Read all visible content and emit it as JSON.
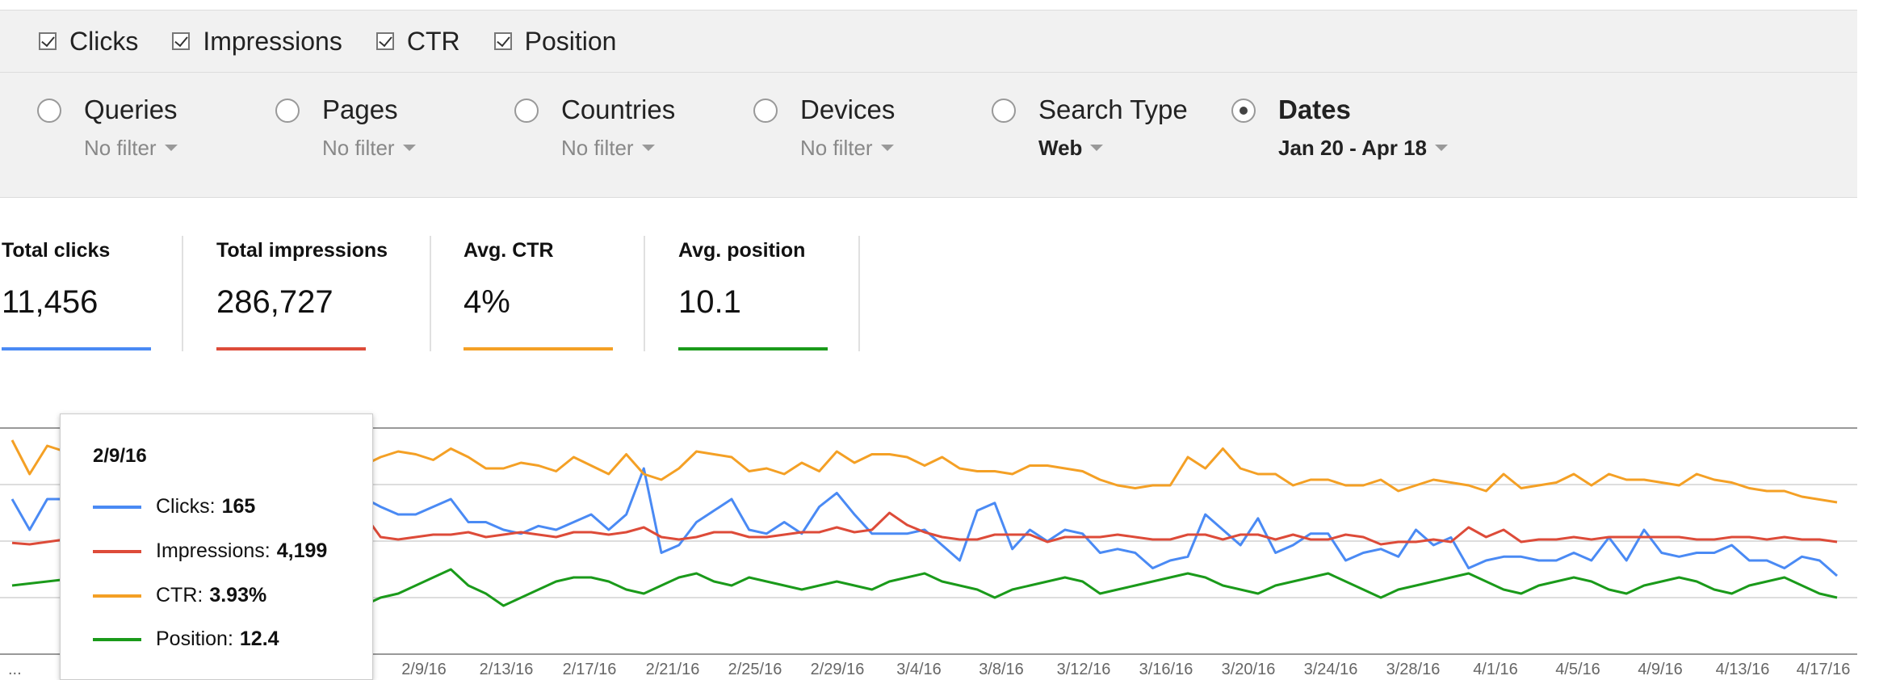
{
  "metrics": [
    {
      "label": "Clicks",
      "checked": true
    },
    {
      "label": "Impressions",
      "checked": true
    },
    {
      "label": "CTR",
      "checked": true
    },
    {
      "label": "Position",
      "checked": true
    }
  ],
  "filters": [
    {
      "title": "Queries",
      "value": "No filter",
      "selected": false
    },
    {
      "title": "Pages",
      "value": "No filter",
      "selected": false
    },
    {
      "title": "Countries",
      "value": "No filter",
      "selected": false
    },
    {
      "title": "Devices",
      "value": "No filter",
      "selected": false
    },
    {
      "title": "Search Type",
      "value": "Web",
      "selected": false
    },
    {
      "title": "Dates",
      "value": "Jan 20 - Apr 18",
      "selected": true
    }
  ],
  "scorecards": [
    {
      "label": "Total clicks",
      "value": "11,456",
      "color": "#4a8af4"
    },
    {
      "label": "Total impressions",
      "value": "286,727",
      "color": "#dd4b39"
    },
    {
      "label": "Avg. CTR",
      "value": "4%",
      "color": "#f4a025"
    },
    {
      "label": "Avg. position",
      "value": "10.1",
      "color": "#1a9a1a"
    }
  ],
  "tooltip": {
    "date": "2/9/16",
    "rows": [
      {
        "label": "Clicks:",
        "value": "165",
        "color": "#4a8af4"
      },
      {
        "label": "Impressions:",
        "value": "4,199",
        "color": "#dd4b39"
      },
      {
        "label": "CTR:",
        "value": "3.93%",
        "color": "#f4a025"
      },
      {
        "label": "Position:",
        "value": "12.4",
        "color": "#1a9a1a"
      }
    ]
  },
  "chart_data": {
    "type": "line",
    "x_tick_labels": [
      "...",
      "2/9/16",
      "2/13/16",
      "2/17/16",
      "2/21/16",
      "2/25/16",
      "2/29/16",
      "3/4/16",
      "3/8/16",
      "3/12/16",
      "3/16/16",
      "3/20/16",
      "3/24/16",
      "3/28/16",
      "4/1/16",
      "4/5/16",
      "4/9/16",
      "4/13/16",
      "4/17/16"
    ],
    "grid": true,
    "highlight_index": 20,
    "series": [
      {
        "name": "Clicks",
        "color": "#4a8af4",
        "values": [
          0.6,
          0.2,
          0.6,
          0.6,
          0.5,
          0.45,
          0.4,
          0.4,
          0.45,
          0.5,
          0.55,
          0.5,
          0.55,
          0.5,
          0.4,
          0.45,
          0.5,
          0.55,
          0.9,
          0.2,
          0.62,
          0.5,
          0.4,
          0.4,
          0.5,
          0.6,
          0.3,
          0.3,
          0.2,
          0.15,
          0.25,
          0.2,
          0.3,
          0.4,
          0.2,
          0.4,
          1.0,
          -0.1,
          0.0,
          0.3,
          0.45,
          0.6,
          0.2,
          0.15,
          0.3,
          0.15,
          0.5,
          0.68,
          0.4,
          0.15,
          0.15,
          0.15,
          0.2,
          0.0,
          -0.2,
          0.45,
          0.55,
          -0.05,
          0.2,
          0.05,
          0.2,
          0.15,
          -0.1,
          -0.05,
          -0.1,
          -0.3,
          -0.2,
          -0.15,
          0.4,
          0.2,
          0.0,
          0.35,
          -0.1,
          0.0,
          0.15,
          0.15,
          -0.2,
          -0.1,
          -0.05,
          -0.15,
          0.2,
          0.0,
          0.1,
          -0.3,
          -0.2,
          -0.15,
          -0.15,
          -0.2,
          -0.2,
          -0.1,
          -0.2,
          0.1,
          -0.2,
          0.2,
          -0.1,
          -0.15,
          -0.1,
          -0.1,
          0.0,
          -0.2,
          -0.2,
          -0.3,
          -0.15,
          -0.2,
          -0.4
        ]
      },
      {
        "name": "Impressions",
        "color": "#dd4b39",
        "values": [
          -0.12,
          -0.15,
          -0.1,
          -0.05,
          -0.08,
          -0.05,
          0.0,
          -0.05,
          0.0,
          0.05,
          0.0,
          0.05,
          0.1,
          0.05,
          0.1,
          0.05,
          0.0,
          0.1,
          0.4,
          0.05,
          0.5,
          0.0,
          -0.05,
          0.0,
          0.05,
          0.05,
          0.1,
          0.0,
          0.05,
          0.1,
          0.05,
          0.0,
          0.1,
          0.1,
          0.05,
          0.1,
          0.2,
          0.0,
          -0.05,
          0.0,
          0.1,
          0.1,
          0.0,
          0.0,
          0.05,
          0.1,
          0.1,
          0.2,
          0.1,
          0.15,
          0.5,
          0.25,
          0.1,
          0.0,
          -0.05,
          -0.05,
          0.05,
          0.05,
          0.05,
          -0.1,
          0.0,
          0.0,
          0.0,
          0.05,
          0.0,
          -0.05,
          -0.05,
          0.05,
          0.05,
          -0.05,
          0.05,
          0.05,
          -0.05,
          0.05,
          -0.05,
          -0.05,
          0.05,
          0.0,
          -0.15,
          -0.1,
          -0.1,
          -0.05,
          -0.1,
          0.2,
          0.0,
          0.15,
          -0.1,
          -0.05,
          -0.05,
          0.0,
          -0.05,
          0.0,
          0.0,
          0.0,
          0.0,
          0.0,
          -0.05,
          -0.05,
          0.0,
          0.0,
          -0.05,
          0.0,
          -0.05,
          -0.05,
          -0.1
        ]
      },
      {
        "name": "CTR",
        "color": "#f4a025",
        "values": [
          1.0,
          0.4,
          0.9,
          0.8,
          0.7,
          0.75,
          0.7,
          0.8,
          0.75,
          0.85,
          0.85,
          0.8,
          0.8,
          0.75,
          0.7,
          0.7,
          0.75,
          0.8,
          0.75,
          0.4,
          0.55,
          0.7,
          0.8,
          0.75,
          0.65,
          0.85,
          0.7,
          0.5,
          0.5,
          0.6,
          0.55,
          0.45,
          0.7,
          0.55,
          0.4,
          0.75,
          0.4,
          0.3,
          0.5,
          0.8,
          0.75,
          0.7,
          0.45,
          0.5,
          0.4,
          0.6,
          0.45,
          0.8,
          0.6,
          0.75,
          0.75,
          0.7,
          0.55,
          0.7,
          0.5,
          0.45,
          0.45,
          0.4,
          0.55,
          0.55,
          0.5,
          0.45,
          0.3,
          0.2,
          0.15,
          0.2,
          0.2,
          0.7,
          0.5,
          0.85,
          0.5,
          0.4,
          0.4,
          0.2,
          0.3,
          0.3,
          0.2,
          0.2,
          0.3,
          0.1,
          0.2,
          0.3,
          0.25,
          0.2,
          0.1,
          0.4,
          0.15,
          0.2,
          0.25,
          0.4,
          0.2,
          0.4,
          0.3,
          0.3,
          0.25,
          0.2,
          0.4,
          0.3,
          0.25,
          0.15,
          0.1,
          0.1,
          0.0,
          -0.05,
          -0.1
        ]
      },
      {
        "name": "Position",
        "color": "#1a9a1a",
        "values": [
          -0.5,
          -0.45,
          -0.4,
          -0.35,
          -0.3,
          -0.25,
          -0.2,
          -0.15,
          -0.1,
          -0.05,
          0.0,
          -0.05,
          -0.1,
          -0.05,
          0.0,
          -0.1,
          -0.2,
          -0.1,
          0.0,
          -0.5,
          -1.0,
          -0.8,
          -0.7,
          -0.5,
          -0.3,
          -0.1,
          -0.5,
          -0.7,
          -1.0,
          -0.8,
          -0.6,
          -0.4,
          -0.3,
          -0.3,
          -0.4,
          -0.6,
          -0.7,
          -0.5,
          -0.3,
          -0.2,
          -0.4,
          -0.5,
          -0.3,
          -0.4,
          -0.5,
          -0.6,
          -0.5,
          -0.4,
          -0.5,
          -0.6,
          -0.4,
          -0.3,
          -0.2,
          -0.4,
          -0.5,
          -0.6,
          -0.8,
          -0.6,
          -0.5,
          -0.4,
          -0.3,
          -0.4,
          -0.7,
          -0.6,
          -0.5,
          -0.4,
          -0.3,
          -0.2,
          -0.3,
          -0.5,
          -0.6,
          -0.7,
          -0.5,
          -0.4,
          -0.3,
          -0.2,
          -0.4,
          -0.6,
          -0.8,
          -0.6,
          -0.5,
          -0.4,
          -0.3,
          -0.2,
          -0.4,
          -0.6,
          -0.7,
          -0.5,
          -0.4,
          -0.3,
          -0.4,
          -0.6,
          -0.7,
          -0.5,
          -0.4,
          -0.3,
          -0.4,
          -0.6,
          -0.7,
          -0.5,
          -0.4,
          -0.3,
          -0.5,
          -0.7,
          -0.8
        ]
      }
    ]
  }
}
